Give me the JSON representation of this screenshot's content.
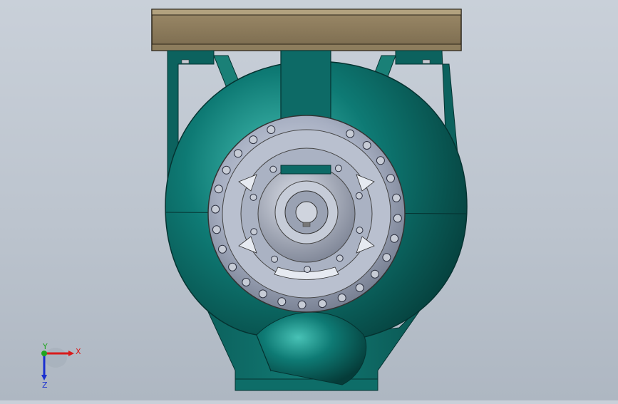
{
  "viewport": {
    "background_top": "#c9d0d9",
    "background_bottom": "#aeb7c2",
    "colors": {
      "volute": "#0d6a66",
      "volute_light": "#3fb0a6",
      "volute_dark": "#06403d",
      "base_plate": "#8b7a5c",
      "flange_metal": "#9aa3b8",
      "bolt": "#c7ccd6"
    }
  },
  "triad": {
    "x_label": "X",
    "y_label": "Y",
    "z_label": "Z",
    "x_color": "#d81b1b",
    "y_color": "#1fa51f",
    "z_color": "#1a2fd0"
  }
}
